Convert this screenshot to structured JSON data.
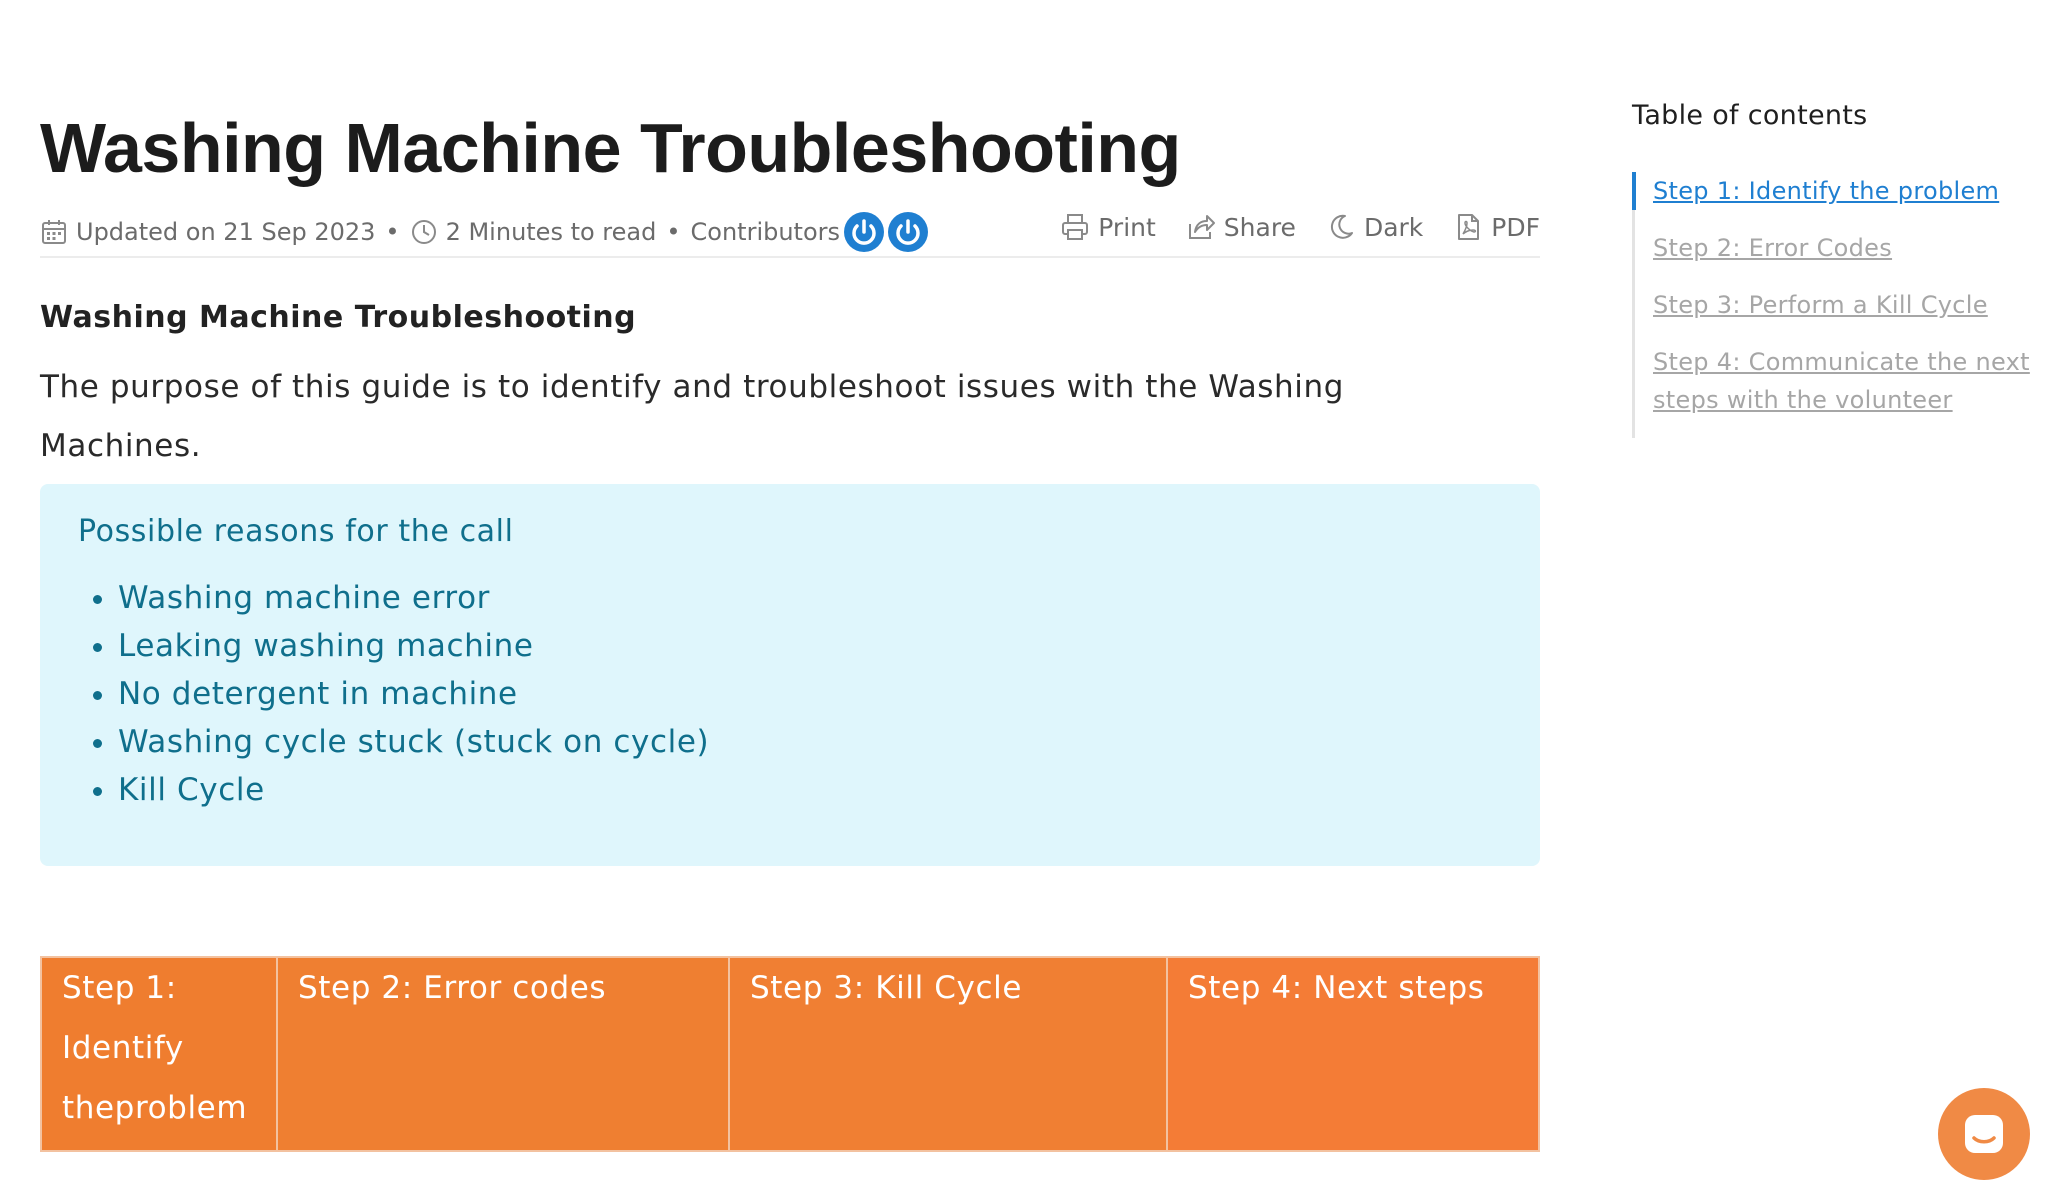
{
  "article": {
    "title": "Washing Machine Troubleshooting",
    "meta": {
      "updated": "Updated on 21 Sep 2023",
      "bullet": "•",
      "read_time": "2 Minutes to read",
      "contributors_label": "Contributors"
    },
    "actions": {
      "print": "Print",
      "share": "Share",
      "dark": "Dark",
      "pdf": "PDF"
    },
    "section_heading": "Washing Machine Troubleshooting",
    "intro": "The purpose of this guide is to identify and troubleshoot issues with the Washing Machines.",
    "callout": {
      "title": "Possible reasons for the call",
      "items": [
        "Washing machine error",
        "Leaking washing machine",
        "No detergent in machine",
        "Washing cycle stuck (stuck on cycle)",
        "Kill Cycle"
      ]
    },
    "steps": [
      {
        "label": "Step 1: Identify theproblem",
        "color": "#ef7d2f"
      },
      {
        "label": "Step 2: Error codes",
        "color": "#ef7f31"
      },
      {
        "label": "Step 3: Kill Cycle",
        "color": "#f07f33"
      },
      {
        "label": "Step 4: Next steps",
        "color": "#f47c36"
      }
    ]
  },
  "toc": {
    "title": "Table of contents",
    "items": [
      "Step 1: Identify the problem",
      "Step 2: Error Codes",
      "Step 3: Perform a Kill Cycle",
      "Step 4: Communicate the next steps with the volunteer"
    ]
  },
  "colors": {
    "accent": "#1f7fd1",
    "callout_bg": "#dff6fc",
    "callout_text": "#0f6f8c",
    "chat": "#f08a45"
  },
  "icons": [
    "calendar-icon",
    "clock-icon",
    "print-icon",
    "share-icon",
    "moon-icon",
    "pdf-icon",
    "chat-icon"
  ]
}
